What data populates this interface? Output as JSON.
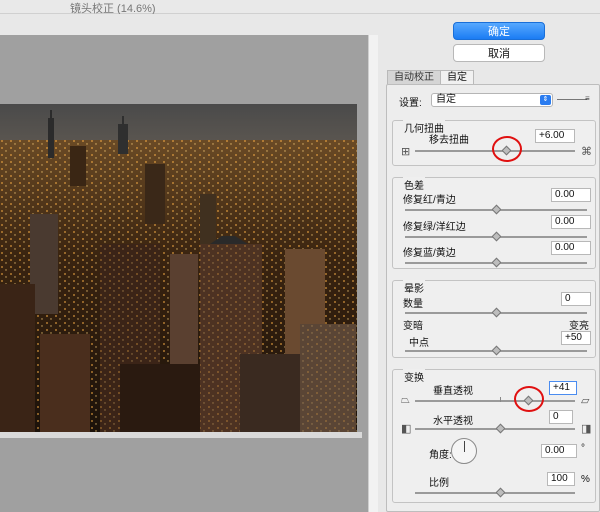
{
  "window": {
    "title": "镜头校正 (14.6%)"
  },
  "buttons": {
    "ok": "确定",
    "cancel": "取消"
  },
  "tabs": [
    {
      "label": "自动校正",
      "active": false
    },
    {
      "label": "自定",
      "active": true
    }
  ],
  "settings": {
    "label": "设置:",
    "value": "自定"
  },
  "geometric": {
    "title": "几何扭曲",
    "remove_label": "移去扭曲",
    "value": "+6.00",
    "slider_fraction": 0.53
  },
  "chromatic": {
    "title": "色差",
    "rows": [
      {
        "label": "修复红/青边",
        "value": "0.00"
      },
      {
        "label": "修复绿/洋红边",
        "value": "0.00"
      },
      {
        "label": "修复蓝/黄边",
        "value": "0.00"
      }
    ]
  },
  "vignette": {
    "title": "晕影",
    "amount_label": "数量",
    "amount_value": "0",
    "darken_label": "变暗",
    "lighten_label": "变亮",
    "midpoint_label": "中点",
    "midpoint_value": "+50"
  },
  "transform": {
    "title": "变换",
    "vertical_label": "垂直透视",
    "vertical_value": "+41",
    "horizontal_label": "水平透视",
    "horizontal_value": "0",
    "angle_label": "角度:",
    "angle_value": "0.00",
    "angle_unit": "°",
    "scale_label": "比例",
    "scale_value": "100",
    "scale_unit": "%"
  },
  "colors": {
    "accent": "#1b7cf3",
    "highlight_ring": "#e01010"
  },
  "icons": [
    "grid-icon",
    "pincushion-icon",
    "perspective-vertical-left-icon",
    "perspective-vertical-right-icon",
    "perspective-horizontal-left-icon",
    "perspective-horizontal-right-icon",
    "dropdown-arrow-icon",
    "menu-icon"
  ]
}
